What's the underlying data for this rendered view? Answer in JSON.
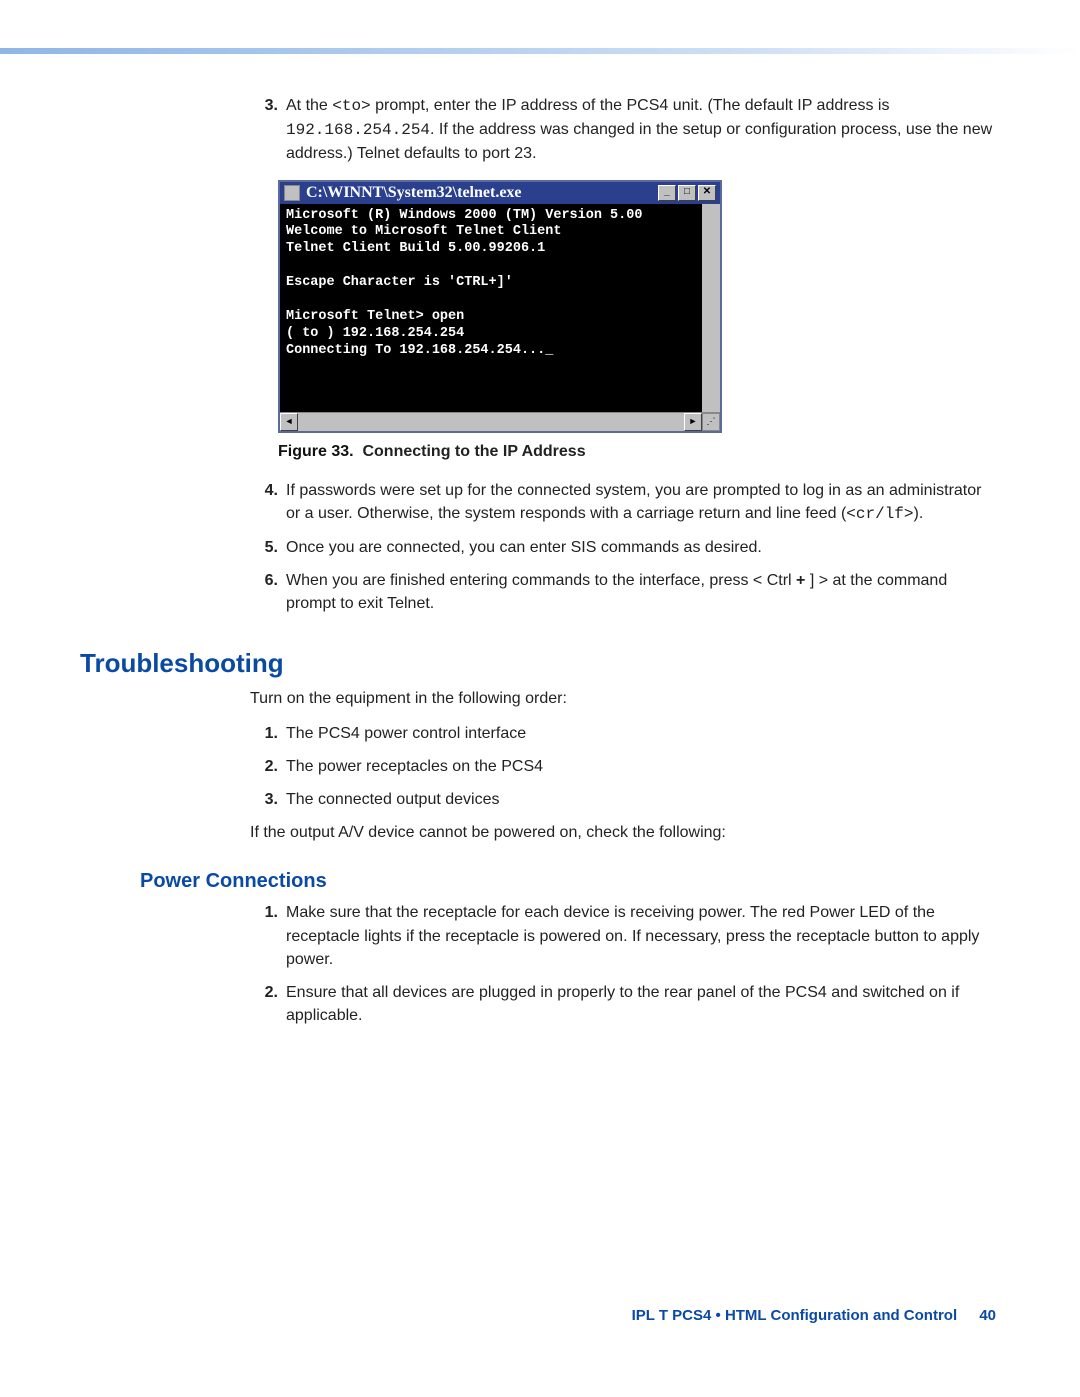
{
  "step3": {
    "num": "3.",
    "text_a": "At the ",
    "code_a": "<to>",
    "text_b": " prompt, enter the IP address of the PCS4 unit. (The default IP address is ",
    "code_b": "192.168.254.254",
    "text_c": ". If the address was changed in the setup or configuration process, use the new address.) Telnet defaults to port 23."
  },
  "telnet": {
    "title": "C:\\WINNT\\System32\\telnet.exe",
    "body": "Microsoft (R) Windows 2000 (TM) Version 5.00\nWelcome to Microsoft Telnet Client\nTelnet Client Build 5.00.99206.1\n\nEscape Character is 'CTRL+]'\n\nMicrosoft Telnet> open\n( to ) 192.168.254.254\nConnecting To 192.168.254.254..._",
    "btn_min": "_",
    "btn_max": "□",
    "btn_close": "✕"
  },
  "figure": {
    "label": "Figure 33.",
    "caption": "Connecting to the IP Address"
  },
  "step4": {
    "num": "4.",
    "text_a": "If passwords were set up for the connected system, you are prompted to log in as an administrator or a user. Otherwise, the system responds with a carriage return and line feed (",
    "code": "<cr/lf>",
    "text_b": ")."
  },
  "step5": {
    "num": "5.",
    "text": "Once you are connected, you can enter SIS commands as desired."
  },
  "step6": {
    "num": "6.",
    "text_a": "When you are finished entering commands to the interface, press < Ctrl ",
    "bold": "+",
    "text_b": " ] >  at the command prompt to exit Telnet."
  },
  "troubleshooting": {
    "heading": "Troubleshooting",
    "intro": "Turn on the equipment in the following order:",
    "i1": {
      "num": "1.",
      "text": "The PCS4 power control interface"
    },
    "i2": {
      "num": "2.",
      "text": "The power receptacles on the PCS4"
    },
    "i3": {
      "num": "3.",
      "text": "The connected output devices"
    },
    "outro": "If the output A/V device cannot be powered on, check the following:"
  },
  "power": {
    "heading": "Power Connections",
    "p1": {
      "num": "1.",
      "text": "Make sure that the receptacle for each device is receiving power. The red Power LED of the receptacle lights if the receptacle is powered on. If necessary, press the receptacle button to apply power."
    },
    "p2": {
      "num": "2.",
      "text": "Ensure that all devices are plugged in properly to the rear panel of the PCS4 and switched on if applicable."
    }
  },
  "footer": {
    "text": "IPL T PCS4 • HTML Configuration and Control",
    "page": "40"
  }
}
